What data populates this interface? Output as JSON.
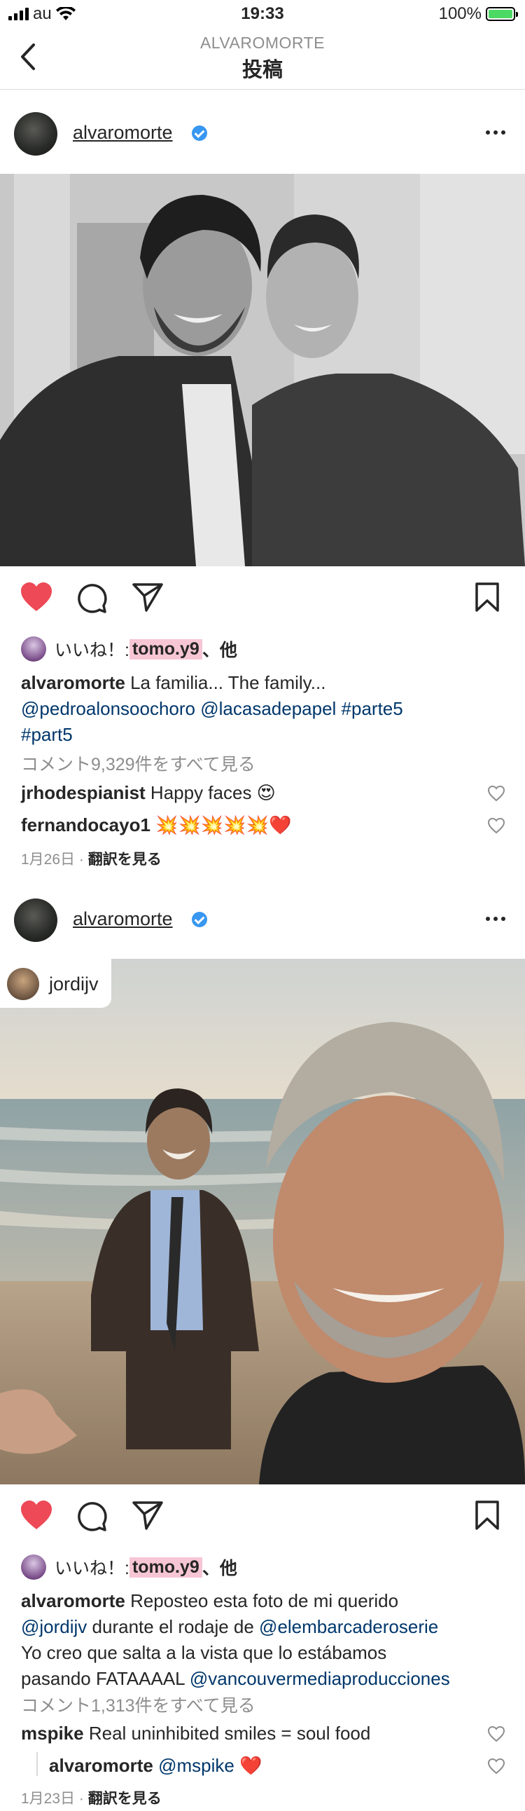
{
  "status": {
    "carrier": "au",
    "time": "19:33",
    "battery": "100%"
  },
  "nav": {
    "subtitle": "ALVAROMORTE",
    "title": "投稿"
  },
  "colors": {
    "like_heart": "#ed4956",
    "link": "#00376b",
    "verified": "#3897f0",
    "highlight": "#f7c6d5"
  },
  "post1": {
    "username": "alvaromorte",
    "likes_prefix": "いいね！: ",
    "likes_user": "tomo.y9",
    "likes_suffix": "、他",
    "caption_user": "alvaromorte",
    "caption_text": " La familia... The family...",
    "caption_links": "@pedroalonsoochoro @lacasadepapel #parte5",
    "caption_links2": "#part5",
    "view_comments": "コメント9,329件をすべて見る",
    "comments": [
      {
        "user": "jrhodespianist",
        "text": " Happy faces 😍"
      },
      {
        "user": "fernandocayo1",
        "text": " 💥💥💥💥💥❤️"
      }
    ],
    "date": "1月26日",
    "translate": "翻訳を見る"
  },
  "post2": {
    "username": "alvaromorte",
    "tagged_user": "jordijv",
    "likes_prefix": "いいね！: ",
    "likes_user": "tomo.y9",
    "likes_suffix": "、他",
    "caption_user": "alvaromorte",
    "caption_line1": " Reposteo esta foto de mi querido",
    "caption_line2_link1": "@jordijv",
    "caption_line2_text": " durante el rodaje de ",
    "caption_line2_link2": "@elembarcaderoserie",
    "caption_line3": "Yo creo que salta a la vista que lo estábamos",
    "caption_line4_text": "pasando FATAAAAL ",
    "caption_line4_link": "@vancouvermediaproducciones",
    "view_comments": "コメント1,313件をすべて見る",
    "comments": [
      {
        "user": "mspike",
        "text": " Real uninhibited smiles = soul food"
      },
      {
        "user": "alvaromorte",
        "link": " @mspike",
        "text": " ❤️"
      }
    ],
    "date": "1月23日",
    "translate": "翻訳を見る"
  }
}
